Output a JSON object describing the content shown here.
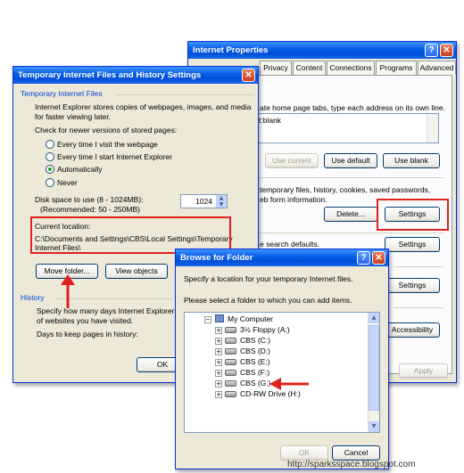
{
  "internet_properties": {
    "title": "Internet Properties",
    "tabs": [
      "Privacy",
      "Content",
      "Connections",
      "Programs",
      "Advanced"
    ],
    "home_text": "ate home page tabs, type each address on its own line.",
    "home_url": "t:blank",
    "use_current": "Use current",
    "use_default": "Use default",
    "use_blank": "Use blank",
    "browsing_text_1": "temporary files, history, cookies, saved passwords,",
    "browsing_text_2": "eb form information.",
    "delete_btn": "Delete...",
    "settings_btn_1": "Settings",
    "search_text": "e search defaults.",
    "settings_btn_2": "Settings",
    "settings_btn_3": "Settings",
    "accessibility_btn": "Accessibility",
    "apply_btn": "Apply"
  },
  "temp_files": {
    "title": "Temporary Internet Files and History Settings",
    "group_title": "Temporary Internet Files",
    "desc_1": "Internet Explorer stores copies of webpages, images, and media",
    "desc_2": "for faster viewing later.",
    "check_label": "Check for newer versions of stored pages:",
    "radio_options": [
      "Every time I visit the webpage",
      "Every time I start Internet Explorer",
      "Automatically",
      "Never"
    ],
    "selected_option": "Automatically",
    "disk_label_1": "Disk space to use (8 - 1024MB):",
    "disk_label_2": "(Recommended: 50 - 250MB)",
    "disk_value": "1024",
    "current_location_label": "Current location:",
    "current_location_1": "C:\\Documents and Settings\\CBS\\Local Settings\\Temporary",
    "current_location_2": "Internet Files\\",
    "move_folder_btn": "Move folder...",
    "view_objects_btn": "View objects",
    "history_title": "History",
    "history_desc_1": "Specify how many days Internet Explorer sh",
    "history_desc_2": "of websites you have visited.",
    "days_label": "Days to keep pages in history:",
    "ok_btn": "OK"
  },
  "browse_folder": {
    "title": "Browse for Folder",
    "instruction": "Specify a location for your temporary Internet files.",
    "select_prompt": "Please select a folder to which you can add items.",
    "tree": [
      "My Computer",
      "3½ Floppy (A:)",
      "CBS (C:)",
      "CBS (D:)",
      "CBS (E:)",
      "CBS (F:)",
      "CBS (G:)",
      "CD-RW Drive (H:)"
    ],
    "ok_btn": "OK",
    "cancel_btn": "Cancel"
  },
  "watermark": "http://sparksspace.blogspot.com",
  "colors": {
    "annotation_red": "#e0211d",
    "title_blue": "#0050d8"
  }
}
